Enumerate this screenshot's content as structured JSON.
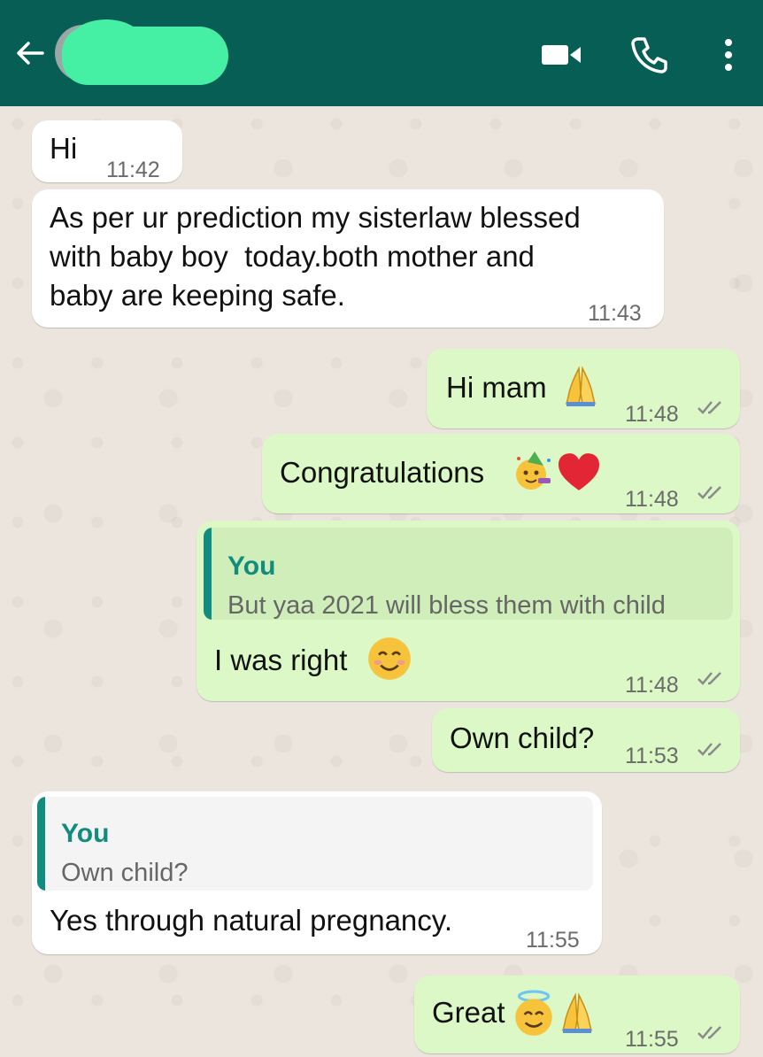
{
  "header": {
    "contact_name": "",
    "icons": [
      "back-arrow-icon",
      "avatar",
      "video-call-icon",
      "voice-call-icon",
      "more-options-icon"
    ],
    "color": "#075e54"
  },
  "messages": [
    {
      "direction": "incoming",
      "text": "Hi",
      "time": "11:42"
    },
    {
      "direction": "incoming",
      "lines": [
        "As per ur prediction my sisterlaw blessed",
        "with baby boy  today.both mother and",
        "baby are keeping safe."
      ],
      "time": "11:43"
    },
    {
      "direction": "outgoing",
      "text": "Hi mam",
      "emoji": [
        "praying-hands"
      ],
      "time": "11:48",
      "status": "read"
    },
    {
      "direction": "outgoing",
      "text": "Congratulations",
      "emoji": [
        "partying-face",
        "red-heart"
      ],
      "time": "11:48",
      "status": "read"
    },
    {
      "direction": "outgoing",
      "quote": {
        "author": "You",
        "text": "But yaa 2021 will bless them with child"
      },
      "text": "I was right",
      "emoji": [
        "smiling-face"
      ],
      "time": "11:48",
      "status": "read"
    },
    {
      "direction": "outgoing",
      "text": "Own child?",
      "time": "11:53",
      "status": "read"
    },
    {
      "direction": "incoming",
      "quote": {
        "author": "You",
        "text": "Own child?"
      },
      "text": "Yes through natural pregnancy.",
      "time": "11:55"
    },
    {
      "direction": "outgoing",
      "text": "Great",
      "emoji": [
        "smiling-face-with-halo",
        "praying-hands"
      ],
      "time": "11:55",
      "status": "read"
    }
  ],
  "colors": {
    "incoming_bubble": "#ffffff",
    "outgoing_bubble": "#dcf8c6",
    "quote_accent": "#128c7e",
    "chat_background": "#ece5dd"
  }
}
